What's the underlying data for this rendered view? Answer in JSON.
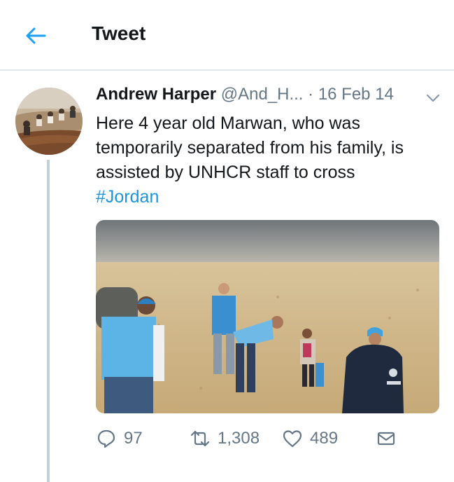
{
  "header": {
    "title": "Tweet",
    "back_icon": "arrow-left-icon"
  },
  "tweet": {
    "author_name": "Andrew Harper",
    "author_handle": "@And_H...",
    "separator": "·",
    "date": "16 Feb 14",
    "text_lines": [
      "Here 4 year old Marwan, who was",
      "temporarily separated from his family, is",
      "assisted by UNHCR staff to cross"
    ],
    "hashtag": "#Jordan",
    "media_description": "Photo of UNHCR staff assisting a child crossing the desert",
    "stats": {
      "replies": "97",
      "retweets": "1,308",
      "likes": "489"
    },
    "icons": [
      "reply-icon",
      "retweet-icon",
      "like-icon",
      "message-icon",
      "chevron-down-icon"
    ]
  },
  "colors": {
    "accent": "#1da1f2",
    "hashtag": "#1b95e0",
    "secondary_text": "#657786",
    "divider": "#e1e8ed",
    "thread_line": "#c4cfd6"
  }
}
